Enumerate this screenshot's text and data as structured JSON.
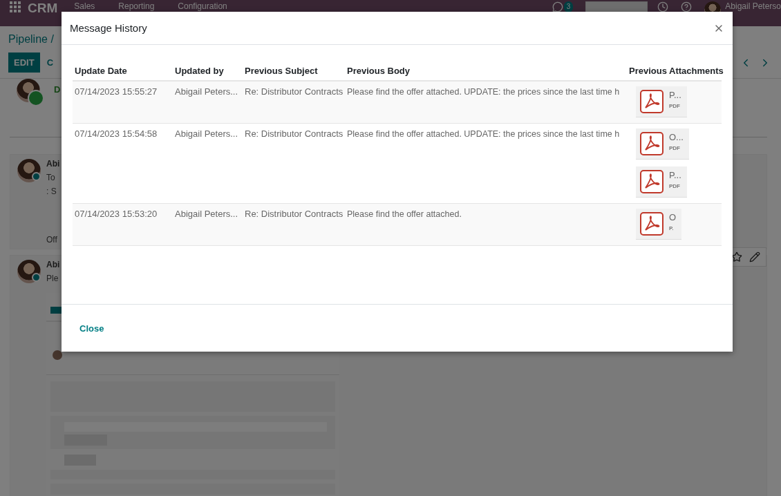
{
  "navbar": {
    "app": "CRM",
    "menu": [
      "Sales",
      "Reporting",
      "Configuration"
    ],
    "message_count": "3",
    "user": "Abigail Peterso"
  },
  "control_panel": {
    "breadcrumb": "Pipeline /",
    "buttons": [
      "EDIT",
      "C"
    ]
  },
  "chatter": {
    "activity": "D",
    "messages": [
      {
        "author": "Abi",
        "lines": [
          "To",
          ": S"
        ],
        "footer": "Off",
        "actions": false
      },
      {
        "author": "Abi",
        "lines": [
          "Ple"
        ],
        "actions": true,
        "attachment": {
          "kind": "picture"
        }
      }
    ]
  },
  "dialog": {
    "title": "Message History",
    "close_label": "Close",
    "columns": [
      "Update Date",
      "Updated by",
      "Previous Subject",
      "Previous Body",
      "Previous Attachments"
    ],
    "rows": [
      {
        "date": "07/14/2023 15:55:27",
        "author": "Abigail Peters...",
        "subject": "Re: Distributor Contracts",
        "body": "Please find the offer attached. UPDATE: the prices since the last time h",
        "attachments": [
          {
            "name": "P...",
            "type": "PDF"
          }
        ]
      },
      {
        "date": "07/14/2023 15:54:58",
        "author": "Abigail Peters...",
        "subject": "Re: Distributor Contracts",
        "body": "Please find the offer attached. UPDATE: the prices since the last time h",
        "attachments": [
          {
            "name": "O...",
            "type": "PDF"
          },
          {
            "name": "P...",
            "type": "PDF"
          }
        ]
      },
      {
        "date": "07/14/2023 15:53:20",
        "author": "Abigail Peters...",
        "subject": "Re: Distributor Contracts",
        "body": "Please find the offer attached.",
        "attachments": [
          {
            "name": "O",
            "type": "P."
          }
        ]
      }
    ]
  }
}
